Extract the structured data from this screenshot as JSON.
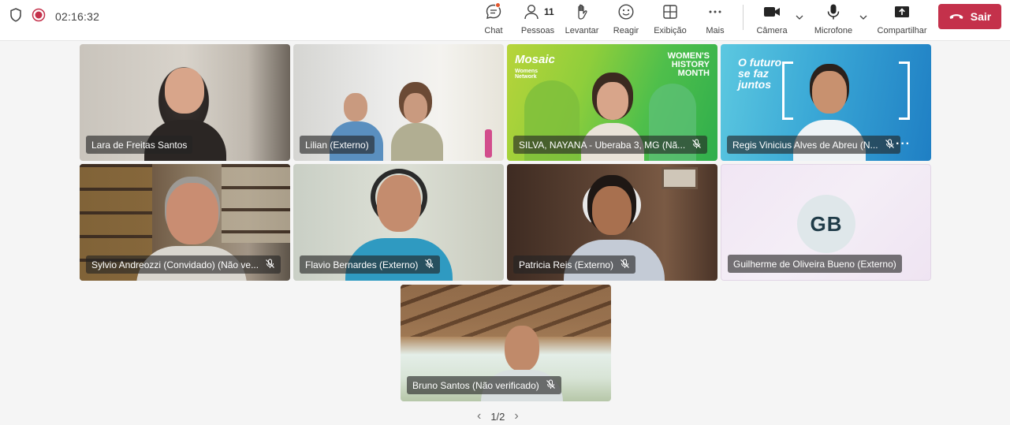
{
  "header": {
    "timer": "02:16:32",
    "chat_label": "Chat",
    "people_label": "Pessoas",
    "people_count": "11",
    "raise_label": "Levantar",
    "react_label": "Reagir",
    "view_label": "Exibição",
    "more_label": "Mais",
    "camera_label": "Câmera",
    "mic_label": "Microfone",
    "share_label": "Compartilhar",
    "leave_label": "Sair"
  },
  "participants": [
    {
      "name": "Lara de Freitas Santos"
    },
    {
      "name": "Lilian (Externo)"
    },
    {
      "name": "SILVA, NAYANA - Uberaba 3, MG (Nã..."
    },
    {
      "name": "Regis Vinicius Alves de Abreu (N..."
    },
    {
      "name": "Sylvio Andreozzi (Convidado) (Não ve..."
    },
    {
      "name": "Flavio Bernardes (Externo)"
    },
    {
      "name": "Patricia Reis (Externo)"
    },
    {
      "name": "Guilherme de Oliveira Bueno (Externo)",
      "initials": "GB"
    },
    {
      "name": "Bruno Santos (Não verificado)"
    }
  ],
  "backgrounds": {
    "mosaic_logo": "Mosaic",
    "mosaic_sub": "Womens Network",
    "womens_month": "WOMEN'S HISTORY MONTH",
    "futuro": "O futuro se faz juntos"
  },
  "pager": {
    "text": "1/2"
  },
  "colors": {
    "leave": "#c4314b",
    "record": "#c4314b",
    "notify": "#e3552c"
  }
}
